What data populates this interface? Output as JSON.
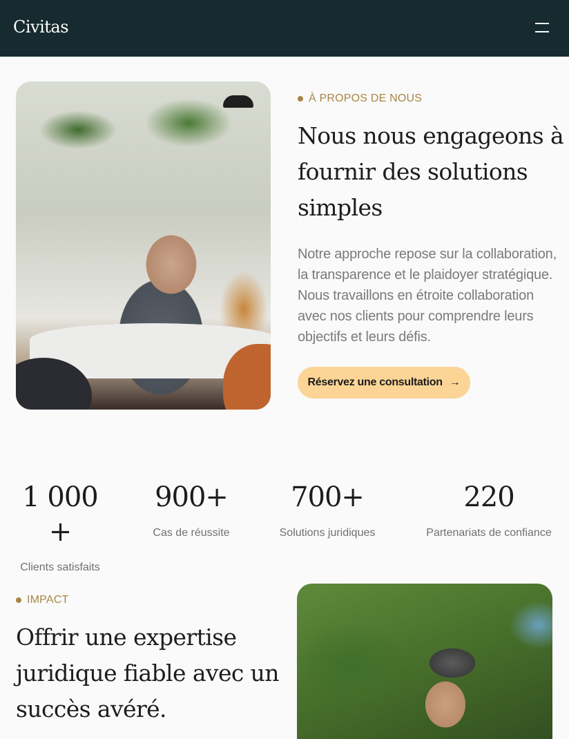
{
  "nav": {
    "logo": "Civitas",
    "menu_icon": "menu-icon"
  },
  "about": {
    "eyebrow": "À PROPOS DE NOUS",
    "heading_lines": [
      "Nous nous engageons à",
      "fournir des solutions",
      "simples"
    ],
    "description": "Notre approche repose sur la collaboration, la transparence et le plaidoyer stratégique. Nous travaillons en étroite collaboration avec nos clients pour comprendre leurs objectifs et leurs défis.",
    "cta_label": "Réservez une consultation",
    "cta_icon": "arrow-right-icon"
  },
  "stats": [
    {
      "value": "1 000 +",
      "label": "Clients satisfaits"
    },
    {
      "value": "900+",
      "label": "Cas de réussite"
    },
    {
      "value": "700+",
      "label": "Solutions juridiques"
    },
    {
      "value": "220",
      "label": "Partenariats de confiance"
    }
  ],
  "impact": {
    "eyebrow": "IMPACT",
    "heading_lines": [
      "Offrir une expertise",
      "juridique fiable avec un",
      "succès avéré."
    ]
  },
  "colors": {
    "nav_bg": "#162a2f",
    "accent": "#a88545",
    "cta_bg": "#fcd596",
    "page_bg": "#fafafa"
  }
}
